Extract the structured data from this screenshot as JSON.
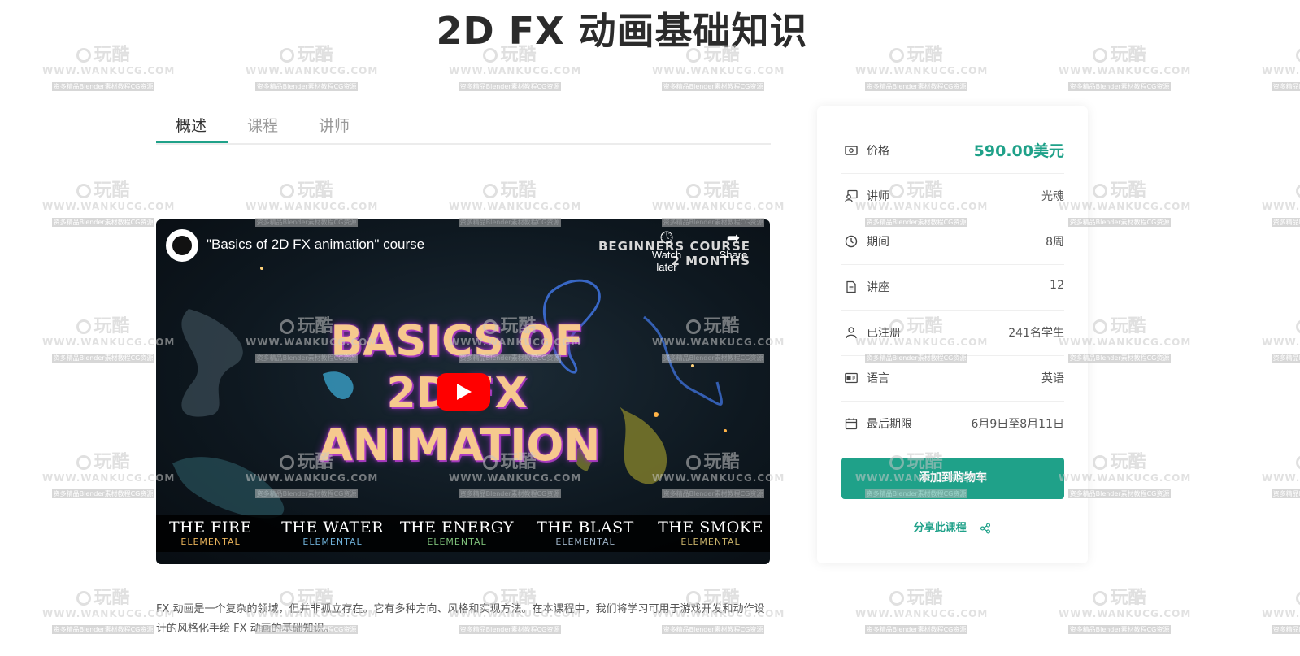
{
  "page": {
    "title": "2D FX 动画基础知识"
  },
  "tabs": [
    {
      "label": "概述",
      "active": true
    },
    {
      "label": "课程",
      "active": false
    },
    {
      "label": "讲师",
      "active": false
    }
  ],
  "video": {
    "title": "\"Basics of 2D FX animation\" course",
    "corner_line1": "BEGINNERS COURSE",
    "corner_line2": "2 MONTHS",
    "watch_later": "Watch later",
    "share": "Share",
    "thumbnail_title": [
      "BASICS OF",
      "2D FX",
      "ANIMATION"
    ],
    "elements": [
      {
        "name": "THE FIRE",
        "sub": "ELEMENTAL",
        "color": "#e8b25a"
      },
      {
        "name": "THE WATER",
        "sub": "ELEMENTAL",
        "color": "#6fb0d8"
      },
      {
        "name": "THE ENERGY",
        "sub": "ELEMENTAL",
        "color": "#7ec07a"
      },
      {
        "name": "THE BLAST",
        "sub": "ELEMENTAL",
        "color": "#9fb4c8"
      },
      {
        "name": "THE SMOKE",
        "sub": "ELEMENTAL",
        "color": "#c9b26a"
      }
    ],
    "play_icon": "youtube-play-icon"
  },
  "description": "FX 动画是一个复杂的领域，但并非孤立存在。它有多种方向、风格和实现方法。在本课程中，我们将学习可用于游戏开发和动作设计的风格化手绘 FX 动画的基础知识。",
  "sidebar": {
    "rows": [
      {
        "icon": "money-icon",
        "label": "价格",
        "value": "590.00美元"
      },
      {
        "icon": "instructor-icon",
        "label": "讲师",
        "value": "光魂"
      },
      {
        "icon": "clock-icon",
        "label": "期间",
        "value": "8周"
      },
      {
        "icon": "document-icon",
        "label": "讲座",
        "value": "12"
      },
      {
        "icon": "user-icon",
        "label": "已注册",
        "value": "241名学生"
      },
      {
        "icon": "language-icon",
        "label": "语言",
        "value": "英语"
      },
      {
        "icon": "calendar-icon",
        "label": "最后期限",
        "value": "6月9日至8月11日"
      }
    ],
    "cart_button": "添加到购物车",
    "share_label": "分享此课程"
  },
  "watermark": {
    "logo_text": "玩酷",
    "url": "WWW.WANKUCG.COM",
    "subtitle": "资多精品Blender素材教程CG资源"
  },
  "colors": {
    "accent": "#1fa189",
    "play_red": "#ff0000"
  }
}
